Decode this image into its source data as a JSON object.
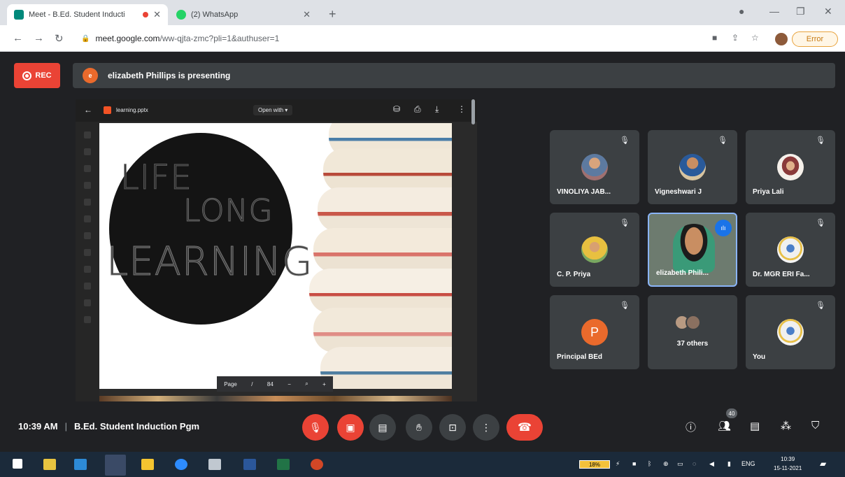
{
  "browser": {
    "tabs": [
      {
        "title": "Meet - B.Ed. Student Inducti",
        "active": true
      },
      {
        "title": "(2) WhatsApp",
        "active": false
      }
    ],
    "url_host": "meet.google.com",
    "url_path": "/ww-qjta-zmc?pli=1&authuser=1",
    "error_label": "Error"
  },
  "meet": {
    "rec_label": "REC",
    "presenter_initial": "e",
    "presenting_text": "elizabeth Phillips is presenting",
    "viewer": {
      "file_name": "learning.pptx",
      "open_with": "Open with",
      "page_label": "Page",
      "page_sep": "/",
      "page_total": "84"
    },
    "slide": {
      "line1": "LIFE",
      "line2": "LONG",
      "line3": "LEARNING"
    },
    "participants": [
      {
        "name": "VINOLIYA JAB..."
      },
      {
        "name": "Vigneshwari J"
      },
      {
        "name": "Priya Lali"
      },
      {
        "name": "C. P. Priya"
      },
      {
        "name": "elizabeth Phili..."
      },
      {
        "name": "Dr. MGR ERI Fa..."
      },
      {
        "name": "Principal BEd",
        "initial": "P"
      },
      {
        "name": "37 others"
      },
      {
        "name": "You"
      }
    ],
    "time": "10:39 AM",
    "meeting_title": "B.Ed. Student Induction Pgm",
    "people_count": "40"
  },
  "taskbar": {
    "battery": "18%",
    "lang": "ENG",
    "time": "10:39",
    "date": "15-11-2021"
  },
  "colors": {
    "accent_red": "#ea4335",
    "tile_bg": "#3c4043",
    "speaking_border": "#8ab4f8"
  }
}
